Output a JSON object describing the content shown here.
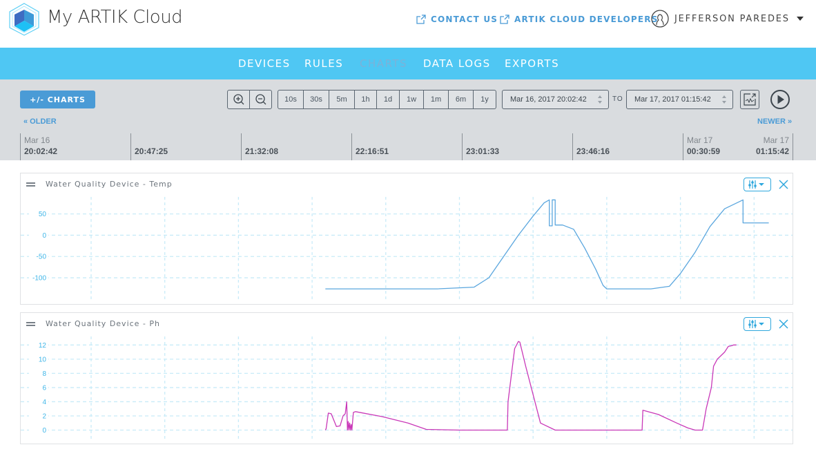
{
  "app": {
    "brand": "My ARTIK Cloud",
    "links": [
      {
        "label": "CONTACT US",
        "icon": "external-link-icon"
      },
      {
        "label": "ARTIK CLOUD DEVELOPERS",
        "icon": "external-link-icon"
      }
    ],
    "user": {
      "name": "JEFFERSON PAREDES",
      "icon": "user-avatar-icon"
    }
  },
  "nav": {
    "items": [
      {
        "label": "DEVICES",
        "active": false
      },
      {
        "label": "RULES",
        "active": false
      },
      {
        "label": "CHARTS",
        "active": true
      },
      {
        "label": "DATA LOGS",
        "active": false
      },
      {
        "label": "EXPORTS",
        "active": false
      }
    ],
    "colors": {
      "bar": "#4fc7f3",
      "active": "#7bb2d9"
    }
  },
  "toolbar": {
    "charts_button": "+/- CHARTS",
    "zoom": {
      "in_icon": "zoom-in-icon",
      "out_icon": "zoom-out-icon"
    },
    "ranges": [
      "10s",
      "30s",
      "5m",
      "1h",
      "1d",
      "1w",
      "1m",
      "6m",
      "1y"
    ],
    "from": "Mar 16, 2017 20:02:42",
    "to_label": "TO",
    "to": "Mar 17, 2017 01:15:42",
    "export_icon": "chart-export-icon",
    "play_icon": "play-icon",
    "older": "« OLDER",
    "newer": "NEWER »"
  },
  "timeline": [
    {
      "date": "Mar 16",
      "time": "20:02:42"
    },
    {
      "date": "",
      "time": "20:47:25"
    },
    {
      "date": "",
      "time": "21:32:08"
    },
    {
      "date": "",
      "time": "22:16:51"
    },
    {
      "date": "",
      "time": "23:01:33"
    },
    {
      "date": "",
      "time": "23:46:16"
    },
    {
      "date": "Mar 17",
      "time": "00:30:59"
    },
    {
      "date": "Mar 17",
      "time": "01:15:42"
    }
  ],
  "chart_data": [
    {
      "type": "line",
      "title": "Water Quality Device - Temp",
      "color": "#5aa6de",
      "yticks": [
        50,
        0,
        -50,
        -100
      ],
      "ylim": [
        -160,
        90
      ],
      "xlim": [
        0,
        10.5
      ],
      "x_grid_count": 10,
      "x": [
        3.18,
        4.7,
        5.2,
        5.4,
        5.6,
        5.8,
        6.0,
        6.15,
        6.22,
        6.22,
        6.26,
        6.26,
        6.3,
        6.3,
        6.4,
        6.55,
        6.7,
        6.85,
        6.95,
        7.0,
        7.6,
        7.85,
        8.0,
        8.2,
        8.4,
        8.6,
        8.85,
        8.85,
        9.2
      ],
      "y": [
        -126,
        -126,
        -122,
        -100,
        -50,
        0,
        45,
        76,
        83,
        22,
        22,
        83,
        83,
        24,
        24,
        14,
        -30,
        -80,
        -118,
        -126,
        -126,
        -120,
        -90,
        -40,
        20,
        62,
        83,
        29,
        29
      ]
    },
    {
      "type": "line",
      "title": "Water Quality Device - Ph",
      "color": "#c938b8",
      "yticks": [
        12,
        10,
        8,
        6,
        4,
        2,
        0
      ],
      "ylim": [
        -1.8,
        13.2
      ],
      "xlim": [
        0,
        10.5
      ],
      "x_grid_count": 10,
      "x": [
        3.18,
        3.19,
        3.22,
        3.26,
        3.33,
        3.38,
        3.42,
        3.45,
        3.47,
        3.48,
        3.49,
        3.5,
        3.51,
        3.52,
        3.53,
        3.54,
        3.56,
        3.59,
        3.95,
        4.3,
        4.55,
        5.0,
        5.45,
        5.65,
        5.66,
        5.75,
        5.8,
        5.82,
        5.9,
        6.0,
        6.1,
        6.3,
        6.6,
        7.0,
        7.2,
        7.48,
        7.49,
        7.7,
        7.95,
        8.1,
        8.2,
        8.25,
        8.3,
        8.35,
        8.42,
        8.45,
        8.5,
        8.6,
        8.65,
        8.7,
        8.72,
        8.76
      ],
      "y": [
        0,
        0.2,
        2.4,
        2.3,
        0.5,
        0.6,
        2.0,
        2.3,
        4.0,
        0.0,
        1.2,
        0.0,
        1.0,
        0.0,
        0.8,
        0.0,
        2.5,
        2.6,
        1.9,
        1.0,
        0.1,
        0.0,
        0.0,
        0.0,
        4.0,
        11.5,
        12.5,
        12.4,
        9.0,
        5.0,
        1.0,
        0.0,
        0.0,
        0.0,
        0.0,
        0.0,
        2.8,
        2.2,
        1.0,
        0.3,
        0.0,
        0.0,
        0.0,
        3.0,
        6.0,
        9.0,
        10.0,
        11.0,
        11.8,
        11.9,
        12.0,
        12.0
      ]
    }
  ],
  "panels": [
    {
      "title": "Water Quality Device - Temp",
      "options_icon": "sliders-dropdown-icon",
      "close_icon": "close-icon"
    },
    {
      "title": "Water Quality Device - Ph",
      "options_icon": "sliders-dropdown-icon",
      "close_icon": "close-icon"
    }
  ]
}
